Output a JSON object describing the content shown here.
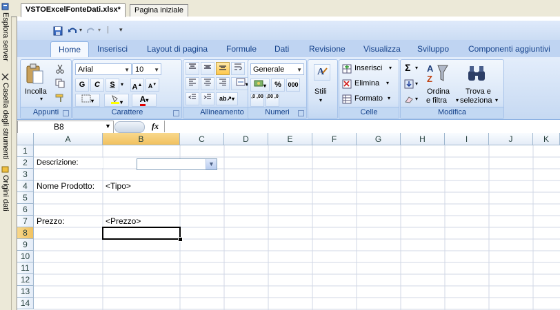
{
  "left_dock": {
    "items": [
      {
        "label": "Esplora server",
        "icon": "server-explorer-icon"
      },
      {
        "label": "Casella degli strumenti",
        "icon": "toolbox-icon"
      },
      {
        "label": "Origini dati",
        "icon": "data-sources-icon"
      }
    ]
  },
  "document_tabs": [
    {
      "label": "VSTOExcelFonteDati.xlsx*",
      "active": true
    },
    {
      "label": "Pagina iniziale",
      "active": false
    }
  ],
  "ribbon": {
    "tabs": [
      "Home",
      "Inserisci",
      "Layout di pagina",
      "Formule",
      "Dati",
      "Revisione",
      "Visualizza",
      "Sviluppo",
      "Componenti aggiuntivi"
    ],
    "active_tab": "Home",
    "groups": {
      "clipboard": {
        "title": "Appunti",
        "paste_label": "Incolla"
      },
      "font": {
        "title": "Carattere",
        "font_name": "Arial",
        "font_size": "10",
        "bold": "G",
        "italic": "C",
        "underline": "S"
      },
      "alignment": {
        "title": "Allineamento"
      },
      "number": {
        "title": "Numeri",
        "format": "Generale",
        "percent": "%",
        "thousands": "000",
        "inc_dec": ",0 ,00",
        "dec_dec": ",00 ,0"
      },
      "styles": {
        "label": "Stili"
      },
      "cells": {
        "title": "Celle",
        "insert": "Inserisci",
        "delete": "Elimina",
        "format": "Formato"
      },
      "editing": {
        "title": "Modifica",
        "sigma": "Σ",
        "sort_line1": "Ordina",
        "sort_line2": "e filtra",
        "find_line1": "Trova e",
        "find_line2": "seleziona"
      }
    },
    "colors": {
      "accent": "#15428b",
      "tab_bg": "#bfd4f2"
    }
  },
  "formula_bar": {
    "name_box": "B8",
    "fx": "fx",
    "formula": ""
  },
  "sheet": {
    "columns": [
      "A",
      "B",
      "C",
      "D",
      "E",
      "F",
      "G",
      "H",
      "I",
      "J",
      "K"
    ],
    "rows": [
      "1",
      "2",
      "3",
      "4",
      "5",
      "6",
      "7",
      "8",
      "9",
      "10",
      "11",
      "12",
      "13",
      "14"
    ],
    "selected_column": "B",
    "selected_row": "8",
    "cells": {
      "A2": "Descrizione:",
      "A4": "Nome Prodotto:",
      "B4": "<Tipo>",
      "A7": "Prezzo:",
      "B7": "<Prezzo>"
    },
    "combo_value": ""
  }
}
